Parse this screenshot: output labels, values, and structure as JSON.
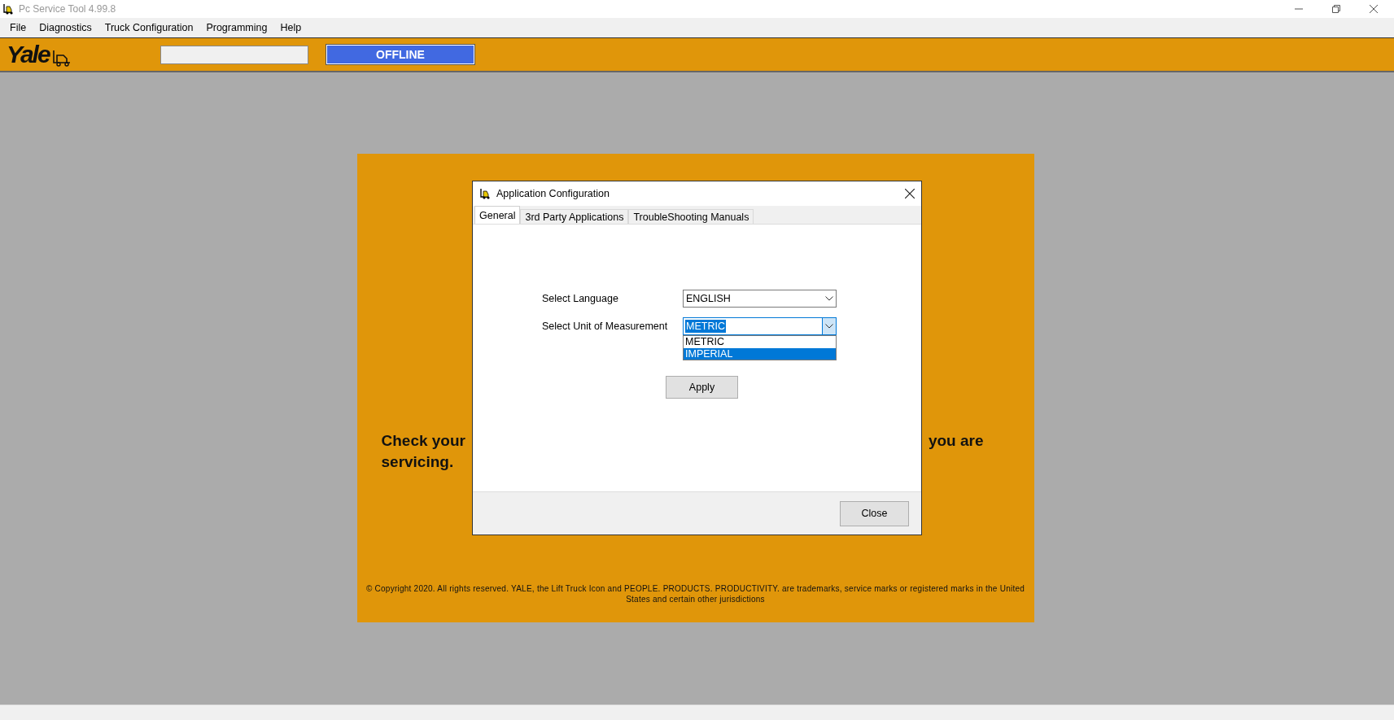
{
  "window": {
    "title": "Pc Service Tool 4.99.8"
  },
  "menu": [
    {
      "label": "File"
    },
    {
      "label": "Diagnostics"
    },
    {
      "label": "Truck Configuration"
    },
    {
      "label": "Programming"
    },
    {
      "label": "Help"
    }
  ],
  "toolbar": {
    "logo": "Yale",
    "status": "OFFLINE"
  },
  "panel": {
    "message_left": "Check your",
    "message_right": "you are",
    "message_line_2": "servicing.",
    "copyright": "© Copyright 2020. All rights reserved. YALE,  the Lift Truck Icon and PEOPLE. PRODUCTS.  PRODUCTIVITY.  are trademarks, service marks or registered marks in the United States and certain other jurisdictions"
  },
  "dialog": {
    "title": "Application Configuration",
    "tabs": [
      {
        "label": "General",
        "selected": true
      },
      {
        "label": "3rd Party Applications",
        "selected": false
      },
      {
        "label": "TroubleShooting Manuals",
        "selected": false
      }
    ],
    "fields": [
      {
        "label": "Select Language",
        "value": "ENGLISH",
        "focused": false
      },
      {
        "label": "Select Unit of Measurement",
        "value": "METRIC",
        "focused": true
      }
    ],
    "dropdown": {
      "options": [
        {
          "label": "METRIC",
          "selected": false
        },
        {
          "label": "IMPERIAL",
          "selected": true
        }
      ]
    },
    "apply": "Apply",
    "close": "Close"
  }
}
